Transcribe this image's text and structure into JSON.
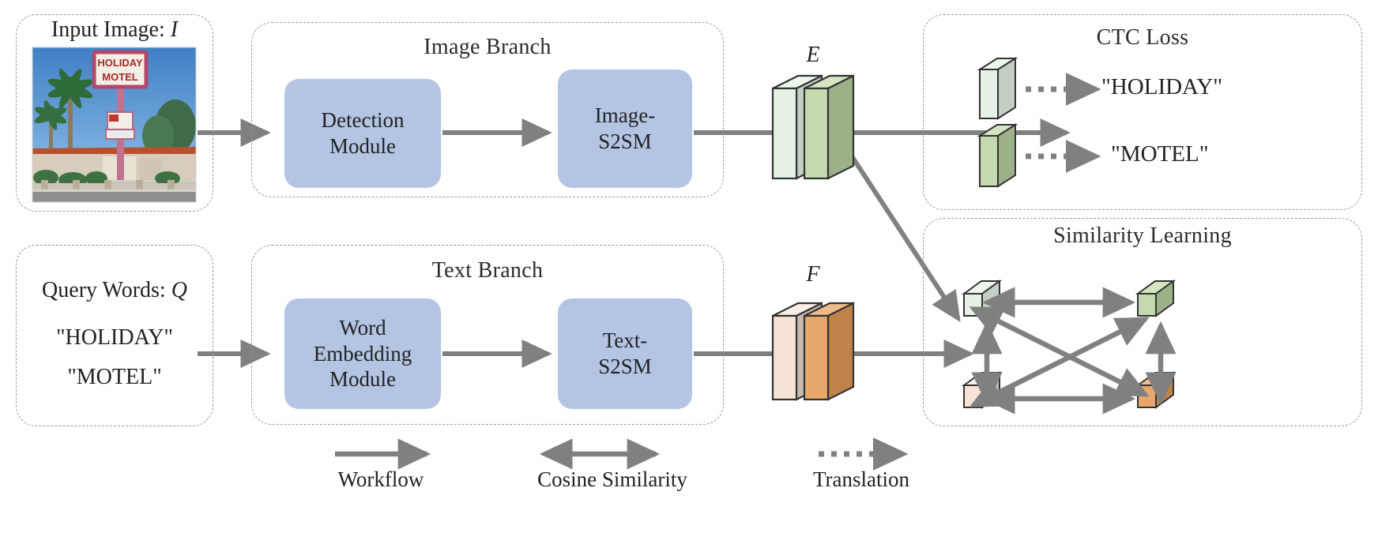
{
  "figure": {
    "type": "architecture-diagram",
    "background": "#ffffff",
    "arrow_color": "#808080",
    "module_fill": "#b4c5e4",
    "panel_border": "#9a9a9a"
  },
  "input_panel": {
    "title_prefix": "Input Image: ",
    "title_symbol": "I",
    "image_alt": "HOLIDAY MOTEL roadside sign with palm trees and motel building"
  },
  "query_panel": {
    "title_prefix": "Query Words: ",
    "title_symbol": "Q",
    "words": [
      "\"HOLIDAY\"",
      "\"MOTEL\""
    ]
  },
  "image_branch": {
    "title": "Image Branch",
    "modules": [
      {
        "label": "Detection\nModule"
      },
      {
        "label": "Image-\nS2SM"
      }
    ]
  },
  "text_branch": {
    "title": "Text Branch",
    "modules": [
      {
        "label": "Word\nEmbedding\nModule"
      },
      {
        "label": "Text-\nS2SM"
      }
    ]
  },
  "features": {
    "image_feature": {
      "label": "E",
      "bars": [
        {
          "name": "image-feature-bar-1",
          "front": "#e6f2e6",
          "side": "#c3cfc3",
          "top": "#eef7ee"
        },
        {
          "name": "image-feature-bar-2",
          "front": "#c5d9ae",
          "side": "#9db189",
          "top": "#d5e5c0"
        }
      ]
    },
    "text_feature": {
      "label": "F",
      "bars": [
        {
          "name": "text-feature-bar-1",
          "front": "#f6e3d5",
          "side": "#c8bbb1",
          "top": "#fbeee4"
        },
        {
          "name": "text-feature-bar-2",
          "front": "#e8a76a",
          "side": "#bf8349",
          "top": "#f0bb8a"
        }
      ]
    }
  },
  "ctc_panel": {
    "title": "CTC Loss",
    "rows": [
      {
        "cube_front": "#e6f2e6",
        "cube_side": "#c3cfc3",
        "cube_top": "#eef7ee",
        "word": "\"HOLIDAY\""
      },
      {
        "cube_front": "#c5d9ae",
        "cube_side": "#9db189",
        "cube_top": "#d5e5c0",
        "word": "\"MOTEL\""
      }
    ]
  },
  "similarity_panel": {
    "title": "Similarity Learning",
    "nodes": [
      {
        "name": "sim-node-top-left",
        "front": "#e6f2e6",
        "side": "#c3cfc3",
        "top": "#eef7ee"
      },
      {
        "name": "sim-node-top-right",
        "front": "#c5d9ae",
        "side": "#9db189",
        "top": "#d5e5c0"
      },
      {
        "name": "sim-node-bottom-left",
        "front": "#f6e3d5",
        "side": "#c8bbb1",
        "top": "#fbeee4"
      },
      {
        "name": "sim-node-bottom-right",
        "front": "#e8a76a",
        "side": "#bf8349",
        "top": "#f0bb8a"
      }
    ]
  },
  "legend": {
    "items": [
      {
        "name": "workflow",
        "label": "Workflow",
        "style": "solid-arrow"
      },
      {
        "name": "cosine-similarity",
        "label": "Cosine Similarity",
        "style": "double-arrow"
      },
      {
        "name": "translation",
        "label": "Translation",
        "style": "dotted-arrow"
      }
    ]
  }
}
